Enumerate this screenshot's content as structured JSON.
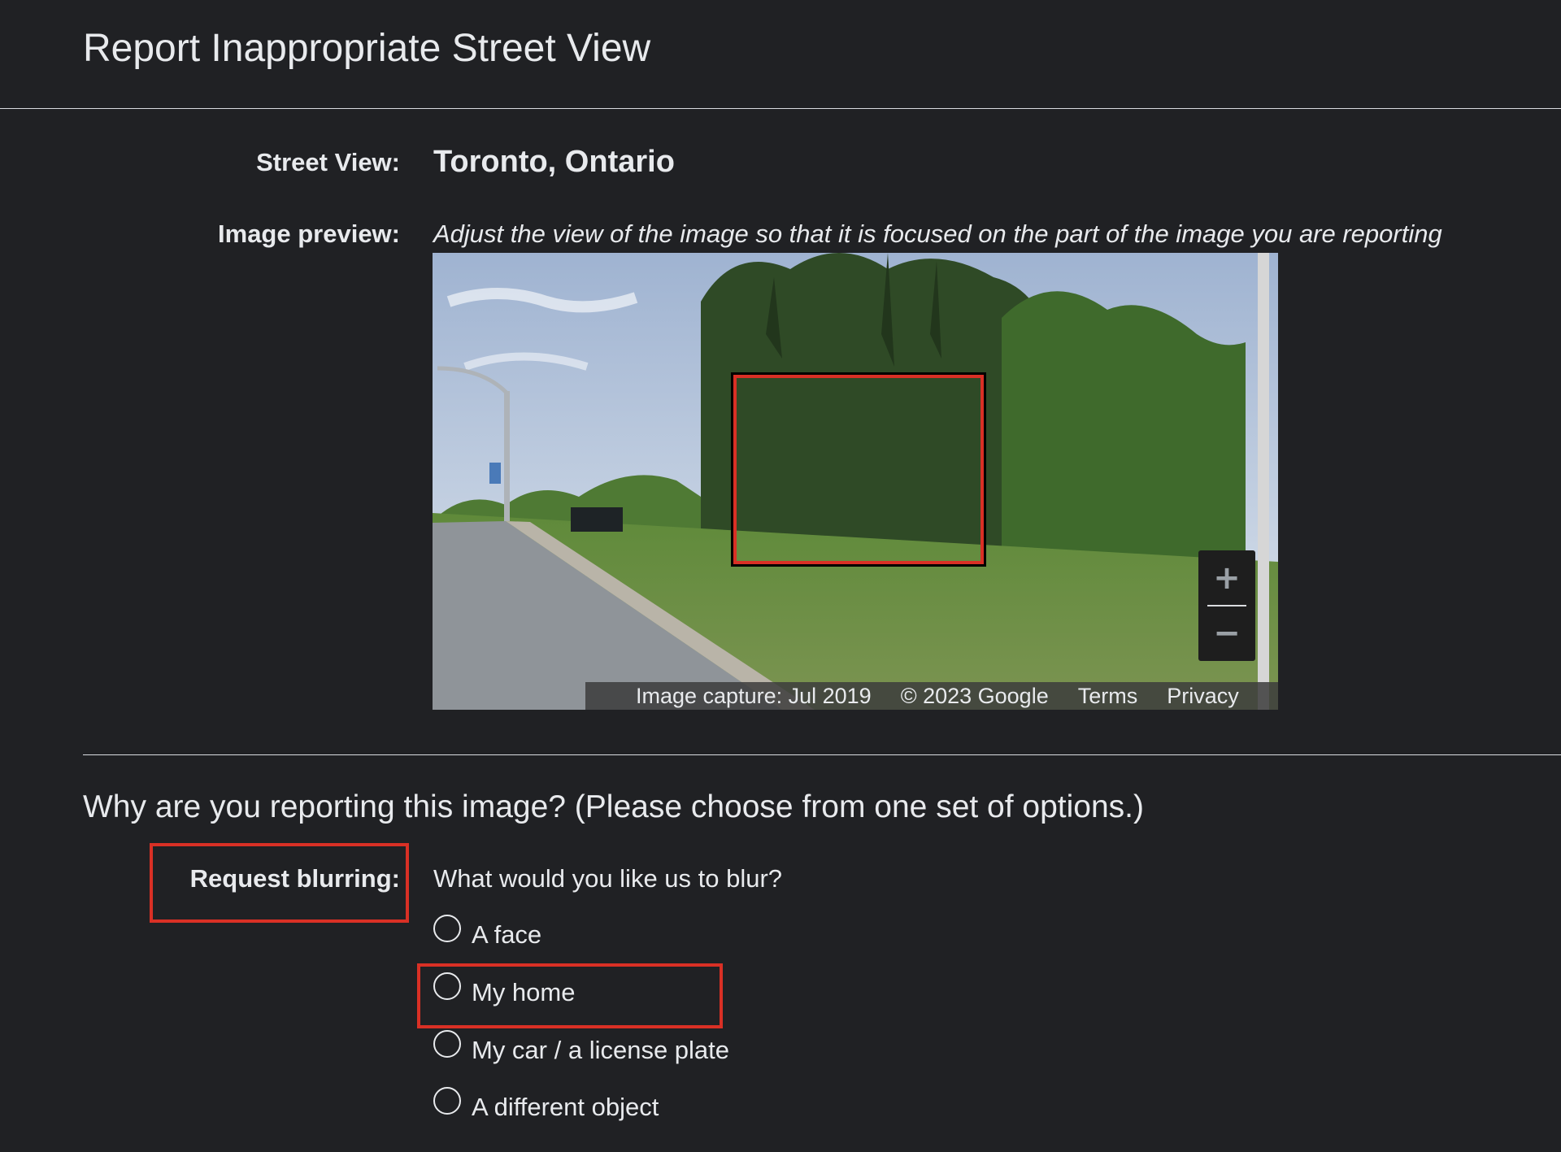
{
  "header": {
    "title": "Report Inappropriate Street View"
  },
  "details": {
    "street_view_label": "Street View:",
    "street_view_value": "Toronto, Ontario",
    "image_preview_label": "Image preview:",
    "image_preview_instructions": "Adjust the view of the image so that it is focused on the part of the image you are reporting"
  },
  "preview": {
    "zoom_in": "+",
    "zoom_out": "−",
    "attribution": {
      "capture": "Image capture: Jul 2019",
      "copyright": "© 2023 Google",
      "terms": "Terms",
      "privacy": "Privacy"
    }
  },
  "reason": {
    "question": "Why are you reporting this image?  (Please choose from one set of options.)",
    "blur_label": "Request blurring:",
    "blur_question": "What would you like us to blur?",
    "options": [
      {
        "label": "A face",
        "selected": false
      },
      {
        "label": "My home",
        "selected": false
      },
      {
        "label": "My car / a license plate",
        "selected": false
      },
      {
        "label": "A different object",
        "selected": false
      }
    ]
  },
  "colors": {
    "background": "#202124",
    "text": "#e8eaed",
    "highlight": "#d93025"
  }
}
